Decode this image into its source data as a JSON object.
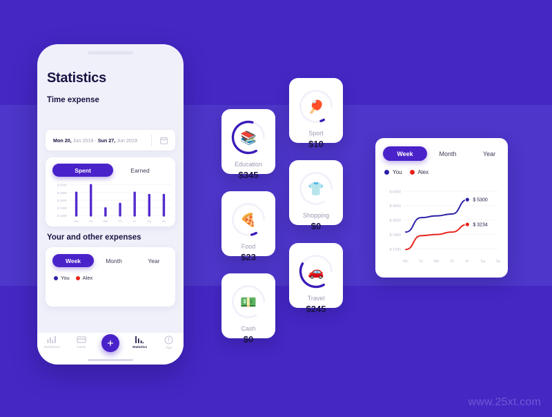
{
  "watermark": "www.25xt.com",
  "colors": {
    "background": "#4527C4",
    "panel": "#4D36C9",
    "accent": "#4A22C9",
    "you": "#2B1FA8",
    "alex": "#E8231C",
    "text_dark": "#181442",
    "text_muted": "#9A9AB2"
  },
  "phone": {
    "title": "Statistics",
    "section_time": "Time expense",
    "date_range": {
      "start_day": "Mon 20,",
      "start_rest": " Jun 2019 - ",
      "end_day": "Sun 27,",
      "end_rest": " Jun 2019",
      "icon": "calendar-icon"
    },
    "toggle": {
      "selected": "Spent",
      "other": "Earned"
    },
    "section_other": "Your and other expenses",
    "period": {
      "selected": "Week",
      "options": [
        "Week",
        "Month",
        "Year"
      ]
    },
    "legend": [
      {
        "label": "You",
        "color": "#2B1FA8"
      },
      {
        "label": "Alex",
        "color": "#E8231C"
      }
    ],
    "tabs": [
      {
        "label": "Dashboard",
        "icon": "bar-chart-icon",
        "active": false
      },
      {
        "label": "Cards",
        "icon": "card-icon",
        "active": false
      },
      {
        "label": "",
        "icon": "plus-icon",
        "active": false
      },
      {
        "label": "Statistics",
        "icon": "stats-icon",
        "active": true
      },
      {
        "label": "Tips",
        "icon": "info-icon",
        "active": false
      }
    ]
  },
  "categories": [
    {
      "name": "Education",
      "value": "$345",
      "emoji": "📚",
      "icon": "books-icon",
      "progress": 0.75,
      "arc_start": 150
    },
    {
      "name": "Food",
      "value": "$23",
      "emoji": "🍕",
      "icon": "pizza-icon",
      "progress": 0.06,
      "arc_start": 150
    },
    {
      "name": "Cash",
      "value": "$0",
      "emoji": "💵",
      "icon": "money-icon",
      "progress": 0,
      "arc_start": 150
    },
    {
      "name": "Sport",
      "value": "$10",
      "emoji": "🏓",
      "icon": "pingpong-icon",
      "progress": 0.04,
      "arc_start": 150
    },
    {
      "name": "Shopping",
      "value": "$0",
      "emoji": "👕",
      "icon": "shirt-icon",
      "progress": 0,
      "arc_start": 150
    },
    {
      "name": "Travel",
      "value": "$245",
      "emoji": "🚗",
      "icon": "car-icon",
      "progress": 0.5,
      "arc_start": 150
    }
  ],
  "line_panel": {
    "period": {
      "selected": "Week",
      "options": [
        "Week",
        "Month",
        "Year"
      ]
    },
    "legend": [
      {
        "label": "You",
        "color": "#2B1FA8"
      },
      {
        "label": "Alex",
        "color": "#E8231C"
      }
    ]
  },
  "chart_data": [
    {
      "type": "bar",
      "title": "Spent",
      "categories": [
        "Mo",
        "Tu",
        "We",
        "Th",
        "Fr",
        "Sa",
        "Su"
      ],
      "values": [
        4750,
        5950,
        2300,
        3000,
        4750,
        4400,
        4400
      ],
      "ytick_labels": [
        "$ 6000",
        "$ 4800",
        "$ 3600",
        "$ 2400",
        "$ 1200"
      ],
      "yticks": [
        6000,
        4800,
        3600,
        2400,
        1200
      ],
      "ylim": [
        1200,
        6400
      ],
      "xlabel": "",
      "ylabel": "",
      "grid": true,
      "series_color": "#4A22C9"
    },
    {
      "type": "line",
      "title": "Your and other expenses",
      "x": [
        "Mo",
        "Tu",
        "We",
        "Th",
        "Fr",
        "Sa",
        "Su"
      ],
      "ytick_labels": [
        "$ 6000",
        "$ 4800",
        "$ 3600",
        "$ 2400",
        "$ 1200"
      ],
      "yticks": [
        6000,
        4800,
        3600,
        2400,
        1200
      ],
      "ylim": [
        1000,
        6400
      ],
      "grid": true,
      "legend_position": "top-left",
      "series": [
        {
          "name": "You",
          "color": "#2B1FA8",
          "values": [
            2600,
            3800,
            3950,
            4100,
            5300,
            null,
            null
          ],
          "end_label": "$ 5300"
        },
        {
          "name": "Alex",
          "color": "#E8231C",
          "values": [
            1150,
            2300,
            2400,
            2600,
            3234,
            null,
            null
          ],
          "end_label": "$ 3234"
        }
      ]
    }
  ]
}
